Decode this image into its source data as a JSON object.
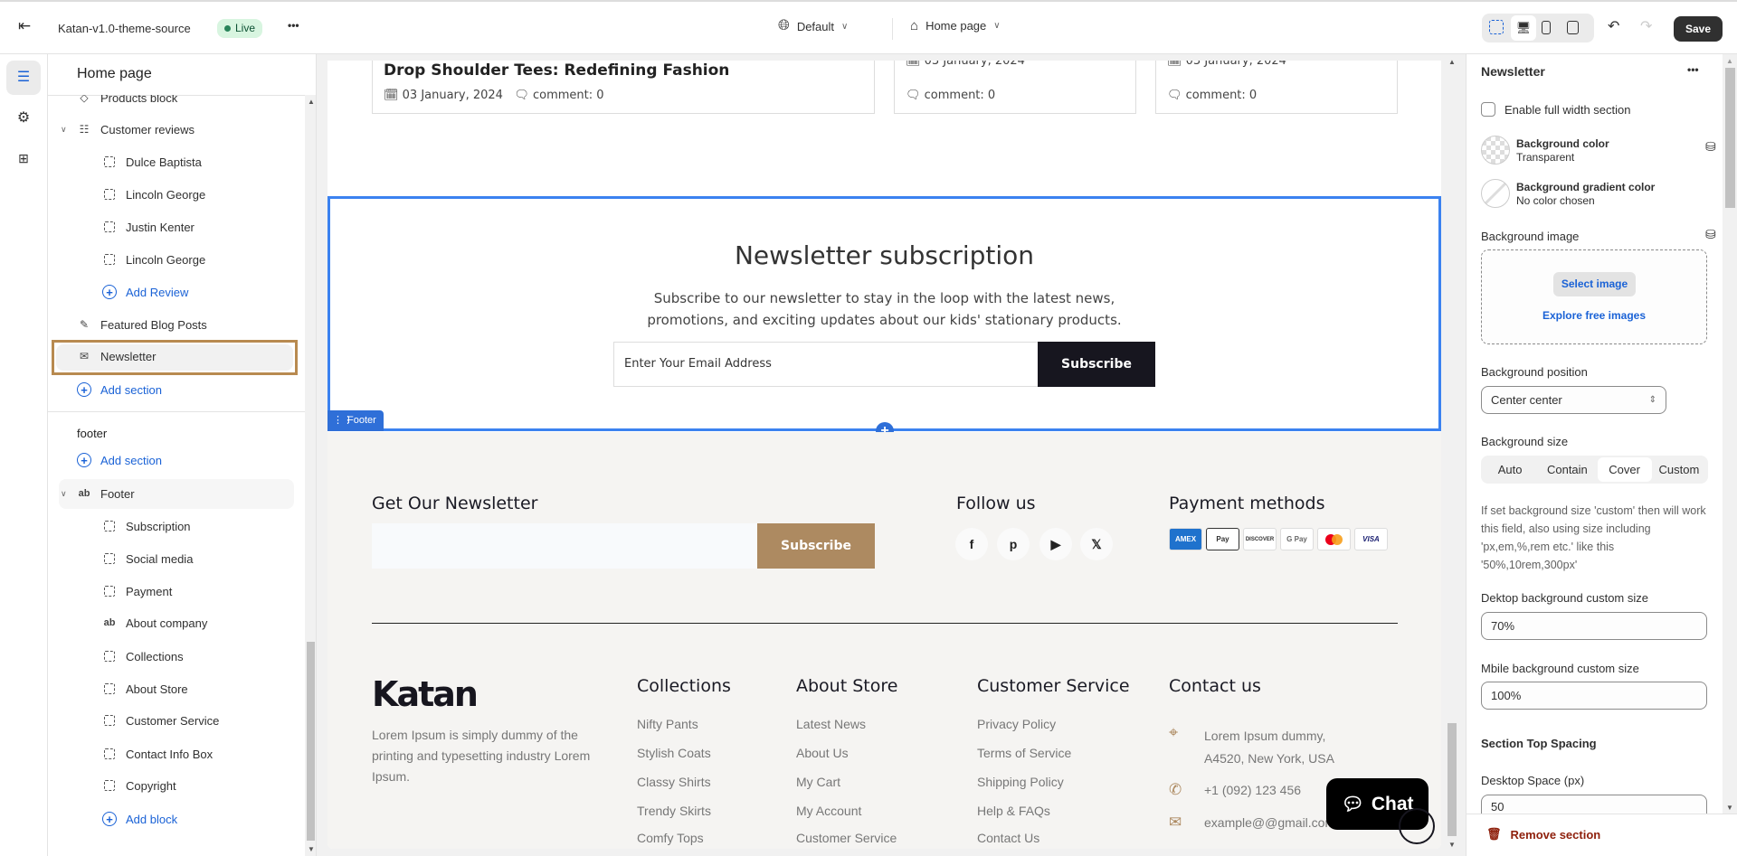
{
  "topbar": {
    "theme_name": "Katan-v1.0-theme-source",
    "status": "Live",
    "more": "•••",
    "locale": "Default",
    "page": "Home page",
    "save": "Save"
  },
  "sidebar": {
    "title": "Home page",
    "items": [
      {
        "label": "Products block"
      },
      {
        "label": "Customer reviews"
      },
      {
        "label": "Dulce Baptista"
      },
      {
        "label": "Lincoln George"
      },
      {
        "label": "Justin Kenter"
      },
      {
        "label": "Lincoln George"
      },
      {
        "label": "Add Review"
      },
      {
        "label": "Featured Blog Posts"
      },
      {
        "label": "Newsletter"
      },
      {
        "label": "Add section"
      }
    ],
    "footer_group": "footer",
    "footer_add": "Add section",
    "footer_section": "Footer",
    "footer_blocks": [
      "Subscription",
      "Social media",
      "Payment",
      "About company",
      "Collections",
      "About Store",
      "Customer Service",
      "Contact Info Box",
      "Copyright"
    ],
    "add_block": "Add block"
  },
  "preview": {
    "blog": {
      "title": "Drop Shoulder Tees: Redefining Fashion",
      "date": "03 January, 2024",
      "comments": "comment: 0"
    },
    "newsletter": {
      "title": "Newsletter subscription",
      "desc1": "Subscribe to our newsletter to stay in the loop with the latest news,",
      "desc2": "promotions, and exciting updates about our kids' stationary products.",
      "placeholder": "Enter Your Email Address",
      "button": "Subscribe"
    },
    "footer_tag": "Footer",
    "footer": {
      "newsletter_title": "Get Our Newsletter",
      "subscribe": "Subscribe",
      "follow": "Follow us",
      "payment": "Payment methods",
      "payments": [
        "AMEX",
        "Pay",
        "DISCOVER",
        "G Pay",
        "MC",
        "VISA"
      ],
      "logo": "Katan",
      "about": "Lorem Ipsum is simply dummy of the printing and typesetting industry Lorem Ipsum.",
      "columns": [
        {
          "title": "Collections",
          "links": [
            "Nifty Pants",
            "Stylish Coats",
            "Classy Shirts",
            "Trendy Skirts",
            "Comfy Tops"
          ]
        },
        {
          "title": "About Store",
          "links": [
            "Latest News",
            "About Us",
            "My Cart",
            "My Account",
            "Customer Service"
          ]
        },
        {
          "title": "Customer Service",
          "links": [
            "Privacy Policy",
            "Terms of Service",
            "Shipping Policy",
            "Help & FAQs",
            "Contact Us"
          ]
        }
      ],
      "contact_title": "Contact us",
      "address1": "Lorem Ipsum dummy,",
      "address2": "A4520, New York, USA",
      "phone": "+1 (092) 123 456",
      "email": "example@@gmail.com"
    },
    "chat": "Chat"
  },
  "panel": {
    "title": "Newsletter",
    "more": "•••",
    "full_width": "Enable full width section",
    "bg_color": "Background color",
    "bg_color_val": "Transparent",
    "grad": "Background gradient color",
    "grad_val": "No color chosen",
    "bg_image": "Background image",
    "select_image": "Select image",
    "explore": "Explore free images",
    "bg_position": "Background position",
    "bg_position_val": "Center center",
    "bg_size": "Background size",
    "sizes": [
      "Auto",
      "Contain",
      "Cover",
      "Custom"
    ],
    "size_selected": "Cover",
    "help": "If set background size 'custom' then will work this field, also using size including 'px,em,%,rem etc.' like this '50%,10rem,300px'",
    "desk_size": "Dektop background custom size",
    "desk_size_val": "70%",
    "mob_size": "Mbile background custom size",
    "mob_size_val": "100%",
    "top_spacing": "Section Top Spacing",
    "desk_space": "Desktop Space (px)",
    "desk_space_val": "50",
    "remove": "Remove section"
  },
  "colors": {
    "accent": "#1a62d6",
    "selection": "#b88a50",
    "brown": "#ad8a61",
    "dark": "#17161f",
    "live": "#d8f5e0"
  }
}
